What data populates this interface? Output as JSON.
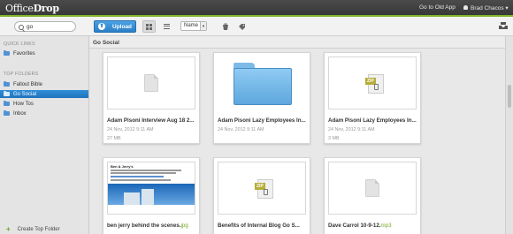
{
  "app": {
    "logo_regular": "Office",
    "logo_bold": "Drop",
    "header_links": {
      "old_app": "Go to Old App",
      "user": "Brad Chacos ▾"
    }
  },
  "toolbar": {
    "search_value": "go",
    "upload_label": "Upload",
    "sort_label": "Name",
    "sort_arrow": "▾",
    "icons": [
      "grid-view-icon",
      "list-view-icon",
      "recycle-icon",
      "tag-icon",
      "tray-icon"
    ]
  },
  "sidebar": {
    "quick_links_heading": "QUICK LINKS",
    "quick_links": [
      {
        "label": "Favorites"
      }
    ],
    "top_folders_heading": "TOP FOLDERS",
    "folders": [
      {
        "label": "Fallout Bible"
      },
      {
        "label": "Go Social",
        "selected": true
      },
      {
        "label": "How Tos"
      },
      {
        "label": "Inbox"
      }
    ],
    "create_label": "Create Top Folder"
  },
  "main": {
    "breadcrumb": "Go Social",
    "cards": [
      {
        "title": "Adam Pisoni Interview Aug 18 2...",
        "date": "24 Nov, 2012 9:11 AM",
        "size": "27 MB",
        "icon": "document-icon"
      },
      {
        "title": "Adam Pisoni Lazy Employees In...",
        "date": "24 Nov, 2012 9:11 AM",
        "size": "",
        "icon": "folder-icon"
      },
      {
        "title": "Adam Pisoni Lazy Employees In...",
        "date": "24 Nov, 2012 9:11 AM",
        "size": "3 MB",
        "icon": "zip-icon",
        "zip_label": "ZIP"
      },
      {
        "title_base": "ben jerry behind the scenes.",
        "title_ext": "jpg",
        "icon": "image-thumbnail",
        "thumb_heading": "Ben & Jerry's"
      },
      {
        "title": "Benefits of Internal Blog Go S...",
        "icon": "zip-icon",
        "zip_label": "ZIP"
      },
      {
        "title_base": "Dave Carrol 10-9-12.",
        "title_ext": "mp3",
        "icon": "document-icon"
      }
    ]
  }
}
